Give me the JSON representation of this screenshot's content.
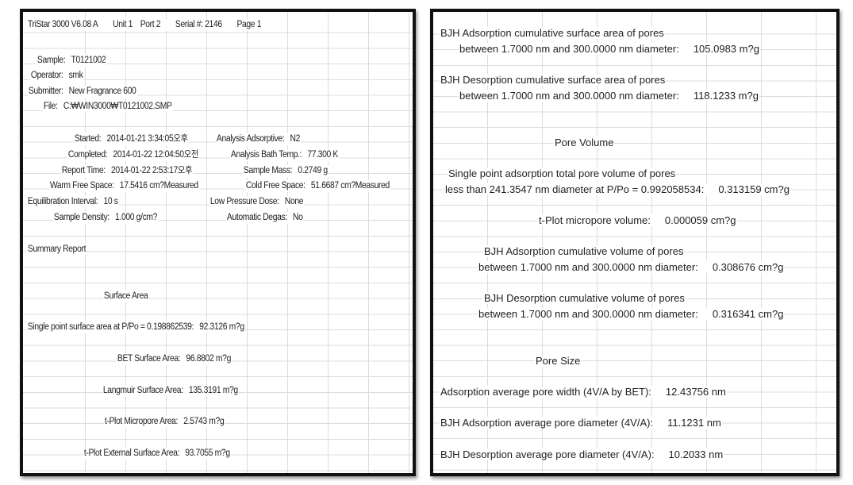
{
  "left": {
    "header": {
      "instrument": "TriStar 3000 V6.08 A",
      "unit": "Unit 1",
      "port": "Port 2",
      "serial": "Serial #: 2146",
      "page": "Page  1"
    },
    "sample": {
      "label": "Sample:",
      "value": "T0121002"
    },
    "operator": {
      "label": "Operator:",
      "value": "smk"
    },
    "submitter": {
      "label": "Submitter:",
      "value": "New Fragrance 600"
    },
    "file": {
      "label": "File:",
      "value": "C:₩WIN3000₩T0121002.SMP"
    },
    "started": {
      "label": "Started:",
      "value": "2014-01-21 3:34:05오후"
    },
    "adsorptive": {
      "label": "Analysis Adsorptive:",
      "value": "N2"
    },
    "completed": {
      "label": "Completed:",
      "value": "2014-01-22 12:04:50오전"
    },
    "bath_temp": {
      "label": "Analysis Bath Temp.:",
      "value": "77.300 K"
    },
    "report_time": {
      "label": "Report Time:",
      "value": "2014-01-22 2:53:17오후"
    },
    "sample_mass": {
      "label": "Sample Mass:",
      "value": "0.2749 g"
    },
    "warm_free": {
      "label": "Warm Free Space:",
      "value": "17.5416 cm?Measured"
    },
    "cold_free": {
      "label": "Cold Free Space:",
      "value": "51.6687 cm?Measured"
    },
    "equil": {
      "label": "Equilibration Interval:",
      "value": "10 s"
    },
    "low_dose": {
      "label": "Low Pressure Dose:",
      "value": "None"
    },
    "density": {
      "label": "Sample Density:",
      "value": "1.000 g/cm?"
    },
    "degas": {
      "label": "Automatic Degas:",
      "value": "No"
    },
    "summary": "Summary Report",
    "surface_area_heading": "Surface Area",
    "single_point": {
      "label": "Single point surface area at P/Po = 0.198862539:",
      "value": "92.3126 m?g"
    },
    "bet": {
      "label": "BET Surface Area:",
      "value": "96.8802 m?g"
    },
    "langmuir": {
      "label": "Langmuir Surface Area:",
      "value": "135.3191 m?g"
    },
    "tplot_micro": {
      "label": "t-Plot Micropore Area:",
      "value": "2.5743 m?g"
    },
    "tplot_ext": {
      "label": "t-Plot External Surface Area:",
      "value": "93.7055 m?g"
    }
  },
  "right": {
    "bjh_ads_area": {
      "line1": "BJH Adsorption cumulative surface area of pores",
      "label": "between 1.7000 nm and 300.0000 nm diameter:",
      "value": "105.0983 m?g"
    },
    "bjh_des_area": {
      "line1": "BJH Desorption cumulative surface area of pores",
      "label": "between 1.7000 nm and 300.0000 nm diameter:",
      "value": "118.1233 m?g"
    },
    "pore_volume_heading": "Pore Volume",
    "single_point_vol": {
      "line1": "Single point adsorption total pore volume of pores",
      "label": "less than 241.3547 nm diameter at P/Po = 0.992058534:",
      "value": "0.313159 cm?g"
    },
    "tplot_micro_vol": {
      "label": "t-Plot micropore volume:",
      "value": "0.000059 cm?g"
    },
    "bjh_ads_vol": {
      "line1": "BJH Adsorption cumulative volume of pores",
      "label": "between 1.7000 nm and 300.0000 nm diameter:",
      "value": "0.308676 cm?g"
    },
    "bjh_des_vol": {
      "line1": "BJH Desorption cumulative volume of pores",
      "label": "between 1.7000 nm and 300.0000 nm diameter:",
      "value": "0.316341 cm?g"
    },
    "pore_size_heading": "Pore Size",
    "ads_avg_width": {
      "label": "Adsorption average pore width (4V/A by BET):",
      "value": "12.43756 nm"
    },
    "bjh_ads_diam": {
      "label": "BJH Adsorption average pore diameter (4V/A):",
      "value": "11.1231 nm"
    },
    "bjh_des_diam": {
      "label": "BJH Desorption average pore diameter (4V/A):",
      "value": "10.2033 nm"
    }
  }
}
